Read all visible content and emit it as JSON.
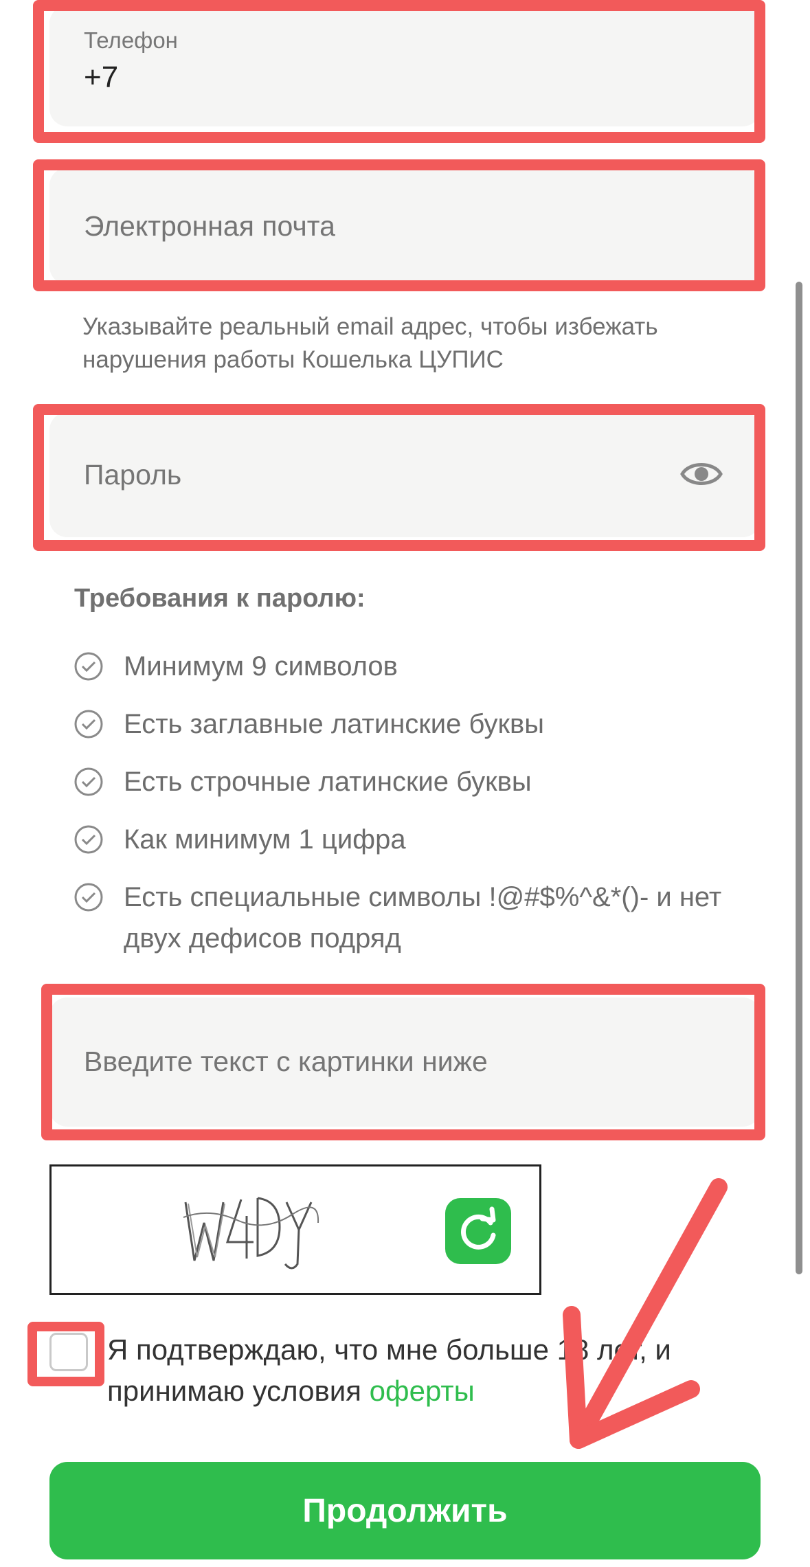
{
  "form": {
    "phone": {
      "label": "Телефон",
      "value": "+7"
    },
    "email": {
      "placeholder": "Электронная почта",
      "hint": "Указывайте реальный email адрес, чтобы избежать нарушения работы Кошелька ЦУПИС"
    },
    "password": {
      "placeholder": "Пароль",
      "icon": "eye-icon"
    },
    "requirements": {
      "title": "Требования к паролю:",
      "items": [
        "Минимум 9 символов",
        "Есть заглавные латинские буквы",
        "Есть строчные латинские буквы",
        "Как минимум 1 цифра",
        "Есть специальные символы !@#$%^&*()- и нет двух дефисов подряд"
      ]
    },
    "captcha": {
      "placeholder": "Введите текст с картинки ниже",
      "image_text": "W4DY",
      "refresh_icon": "refresh-icon"
    },
    "agreement": {
      "text_before": "Я подтверждаю, что мне больше 18 лет, и принимаю условия ",
      "link_text": "оферты"
    },
    "submit_label": "Продолжить"
  },
  "colors": {
    "accent": "#2fbd4d",
    "annotation": "#f25a5a",
    "field_bg": "#f5f5f4"
  }
}
